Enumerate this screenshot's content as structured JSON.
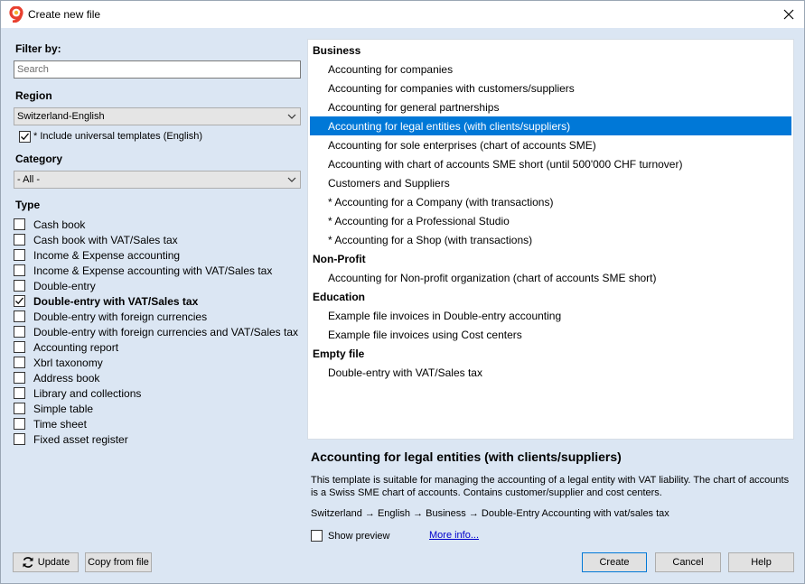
{
  "window": {
    "title": "Create new file"
  },
  "filter": {
    "label": "Filter by:",
    "search_placeholder": "Search",
    "region_label": "Region",
    "region_value": "Switzerland-English",
    "include_universal": {
      "label": "* Include universal templates (English)",
      "checked": true
    },
    "category_label": "Category",
    "category_value": "- All -",
    "type_label": "Type",
    "types": [
      {
        "label": "Cash book",
        "checked": false
      },
      {
        "label": "Cash book with VAT/Sales tax",
        "checked": false
      },
      {
        "label": "Income & Expense accounting",
        "checked": false
      },
      {
        "label": "Income & Expense accounting with VAT/Sales tax",
        "checked": false
      },
      {
        "label": "Double-entry",
        "checked": false
      },
      {
        "label": "Double-entry with VAT/Sales tax",
        "checked": true
      },
      {
        "label": "Double-entry with foreign currencies",
        "checked": false
      },
      {
        "label": "Double-entry with foreign currencies and VAT/Sales tax",
        "checked": false
      },
      {
        "label": "Accounting report",
        "checked": false
      },
      {
        "label": "Xbrl taxonomy",
        "checked": false
      },
      {
        "label": "Address book",
        "checked": false
      },
      {
        "label": "Library and collections",
        "checked": false
      },
      {
        "label": "Simple table",
        "checked": false
      },
      {
        "label": "Time sheet",
        "checked": false
      },
      {
        "label": "Fixed asset register",
        "checked": false
      }
    ]
  },
  "templates": {
    "groups": [
      {
        "name": "Business",
        "items": [
          "Accounting for companies",
          "Accounting for companies with customers/suppliers",
          "Accounting for general partnerships",
          "Accounting for legal entities (with clients/suppliers)",
          "Accounting for sole enterprises (chart of accounts SME)",
          "Accounting with chart of accounts SME short (until 500'000 CHF turnover)",
          "Customers and Suppliers",
          "* Accounting for a Company (with transactions)",
          "* Accounting for a Professional Studio",
          "* Accounting for a Shop (with transactions)"
        ]
      },
      {
        "name": "Non-Profit",
        "items": [
          "Accounting for Non-profit organization (chart of accounts SME short)"
        ]
      },
      {
        "name": "Education",
        "items": [
          "Example file invoices in Double-entry accounting",
          "Example file invoices using Cost centers"
        ]
      },
      {
        "name": "Empty file",
        "items": [
          "Double-entry with VAT/Sales tax"
        ]
      }
    ],
    "selected": "Accounting for legal entities (with clients/suppliers)"
  },
  "description": {
    "title": "Accounting for legal entities (with clients/suppliers)",
    "text": "This template is suitable for managing the accounting of a legal entity with VAT liability. The chart of accounts is a Swiss SME chart of accounts. Contains customer/supplier and cost centers.",
    "path": "Switzerland → English → Business → Double-Entry Accounting with vat/sales tax",
    "show_preview": {
      "label": "Show preview",
      "checked": false
    },
    "more_info": "More info..."
  },
  "buttons": {
    "update": "Update",
    "copy_from_file": "Copy from file",
    "create": "Create",
    "cancel": "Cancel",
    "help": "Help"
  },
  "colors": {
    "selection": "#0078d7",
    "dialog_bg": "#dbe6f3",
    "link": "#0000cc"
  }
}
